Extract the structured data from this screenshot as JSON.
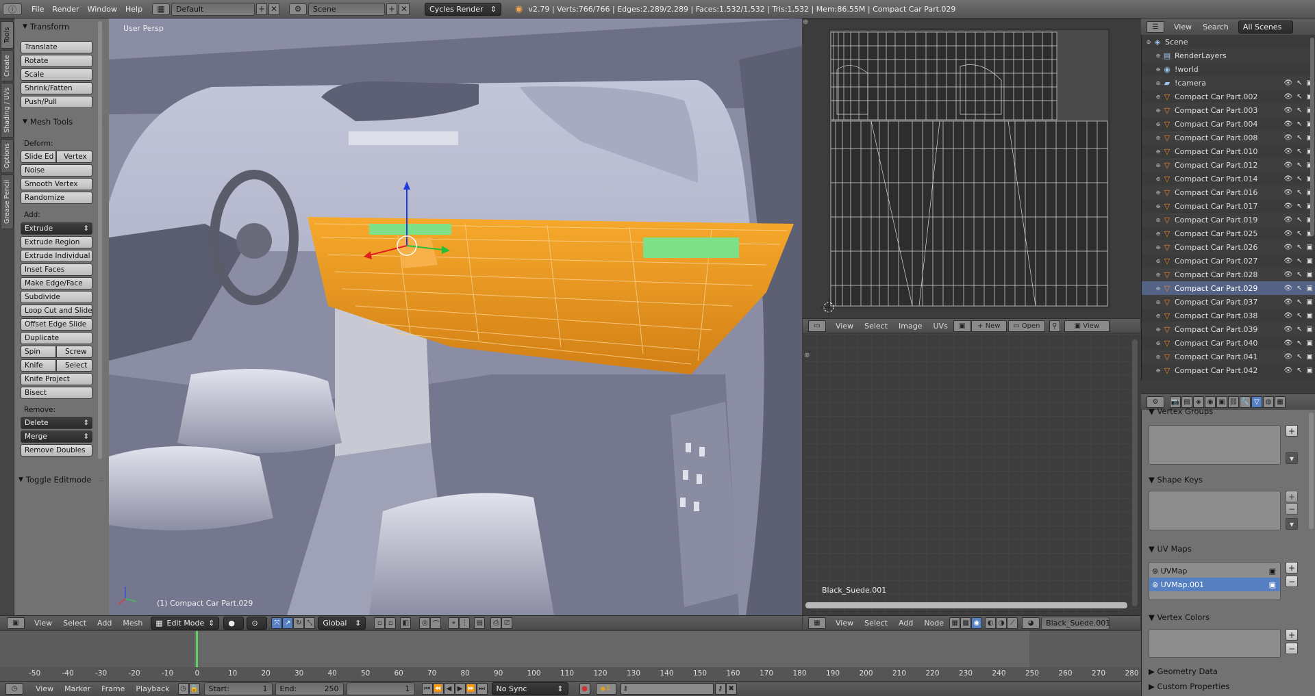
{
  "topbar": {
    "menus": [
      "File",
      "Render",
      "Window",
      "Help"
    ],
    "layout": "Default",
    "scene": "Scene",
    "engine": "Cycles Render",
    "stats": "v2.79 | Verts:766/766 | Edges:2,289/2,289 | Faces:1,532/1,532 | Tris:1,532 | Mem:86.55M | Compact Car Part.029"
  },
  "toolshelf": {
    "tabs": [
      "Tools",
      "Create",
      "Shading / UVs",
      "Options",
      "Grease Pencil"
    ],
    "transform_title": "Transform",
    "transform": [
      "Translate",
      "Rotate",
      "Scale",
      "Shrink/Fatten",
      "Push/Pull"
    ],
    "mesh_tools_title": "Mesh Tools",
    "deform_label": "Deform:",
    "slide_edge": "Slide Ed",
    "vertex": "Vertex",
    "deform": [
      "Noise",
      "Smooth Vertex",
      "Randomize"
    ],
    "add_label": "Add:",
    "extrude": "Extrude",
    "add": [
      "Extrude Region",
      "Extrude Individual",
      "Inset Faces",
      "Make Edge/Face",
      "Subdivide",
      "Loop Cut and Slide",
      "Offset Edge Slide",
      "Duplicate"
    ],
    "spin": "Spin",
    "screw": "Screw",
    "knife": "Knife",
    "select": "Select",
    "knife_project": "Knife Project",
    "bisect": "Bisect",
    "remove_label": "Remove:",
    "delete": "Delete",
    "merge": "Merge",
    "remove_doubles": "Remove Doubles",
    "toggle_editmode": "Toggle Editmode"
  },
  "viewport": {
    "view_label": "User Persp",
    "object_label": "(1) Compact Car Part.029",
    "header_menus": [
      "View",
      "Select",
      "Add",
      "Mesh"
    ],
    "mode": "Edit Mode",
    "orientation": "Global"
  },
  "uv_editor": {
    "menus": [
      "View",
      "Select",
      "Image",
      "UVs"
    ],
    "new_label": "New",
    "open_label": "Open",
    "view_label": "View"
  },
  "node_editor": {
    "material_label": "Black_Suede.001",
    "menus": [
      "View",
      "Select",
      "Add",
      "Node"
    ],
    "material_field": "Black_Suede.001"
  },
  "outliner": {
    "menus": [
      "View",
      "Search"
    ],
    "filter": "All Scenes",
    "items": [
      {
        "name": "Scene",
        "type": "scene"
      },
      {
        "name": "RenderLayers",
        "type": "renderlayers"
      },
      {
        "name": "!world",
        "type": "world"
      },
      {
        "name": "!camera",
        "type": "camera"
      },
      {
        "name": "Compact Car Part.002",
        "type": "mesh"
      },
      {
        "name": "Compact Car Part.003",
        "type": "mesh"
      },
      {
        "name": "Compact Car Part.004",
        "type": "mesh"
      },
      {
        "name": "Compact Car Part.008",
        "type": "mesh"
      },
      {
        "name": "Compact Car Part.010",
        "type": "mesh"
      },
      {
        "name": "Compact Car Part.012",
        "type": "mesh"
      },
      {
        "name": "Compact Car Part.014",
        "type": "mesh"
      },
      {
        "name": "Compact Car Part.016",
        "type": "mesh"
      },
      {
        "name": "Compact Car Part.017",
        "type": "mesh"
      },
      {
        "name": "Compact Car Part.019",
        "type": "mesh"
      },
      {
        "name": "Compact Car Part.025",
        "type": "mesh"
      },
      {
        "name": "Compact Car Part.026",
        "type": "mesh"
      },
      {
        "name": "Compact Car Part.027",
        "type": "mesh"
      },
      {
        "name": "Compact Car Part.028",
        "type": "mesh"
      },
      {
        "name": "Compact Car Part.029",
        "type": "mesh",
        "active": true
      },
      {
        "name": "Compact Car Part.037",
        "type": "mesh"
      },
      {
        "name": "Compact Car Part.038",
        "type": "mesh"
      },
      {
        "name": "Compact Car Part.039",
        "type": "mesh"
      },
      {
        "name": "Compact Car Part.040",
        "type": "mesh"
      },
      {
        "name": "Compact Car Part.041",
        "type": "mesh"
      },
      {
        "name": "Compact Car Part.042",
        "type": "mesh"
      }
    ]
  },
  "properties": {
    "vertex_groups": "Vertex Groups",
    "shape_keys": "Shape Keys",
    "uv_maps": "UV Maps",
    "uv_map_items": [
      "UVMap",
      "UVMap.001"
    ],
    "vertex_colors": "Vertex Colors",
    "geometry_data": "Geometry Data",
    "custom_properties": "Custom Properties"
  },
  "timeline": {
    "ticks": [
      "-50",
      "-40",
      "-30",
      "-20",
      "-10",
      "0",
      "10",
      "20",
      "30",
      "40",
      "50",
      "60",
      "70",
      "80",
      "90",
      "100",
      "110",
      "120",
      "130",
      "140",
      "150",
      "160",
      "170",
      "180",
      "190",
      "200",
      "210",
      "220",
      "230",
      "240",
      "250",
      "260",
      "270",
      "280"
    ],
    "current_frame": 1,
    "menus": [
      "View",
      "Marker",
      "Frame",
      "Playback"
    ],
    "start_label": "Start:",
    "start": "1",
    "end_label": "End:",
    "end": "250",
    "frame": "1",
    "sync": "No Sync"
  },
  "colors": {
    "selection_orange": "#f59a1b",
    "active_blue": "#5680c2",
    "panel_gray": "#727272"
  }
}
